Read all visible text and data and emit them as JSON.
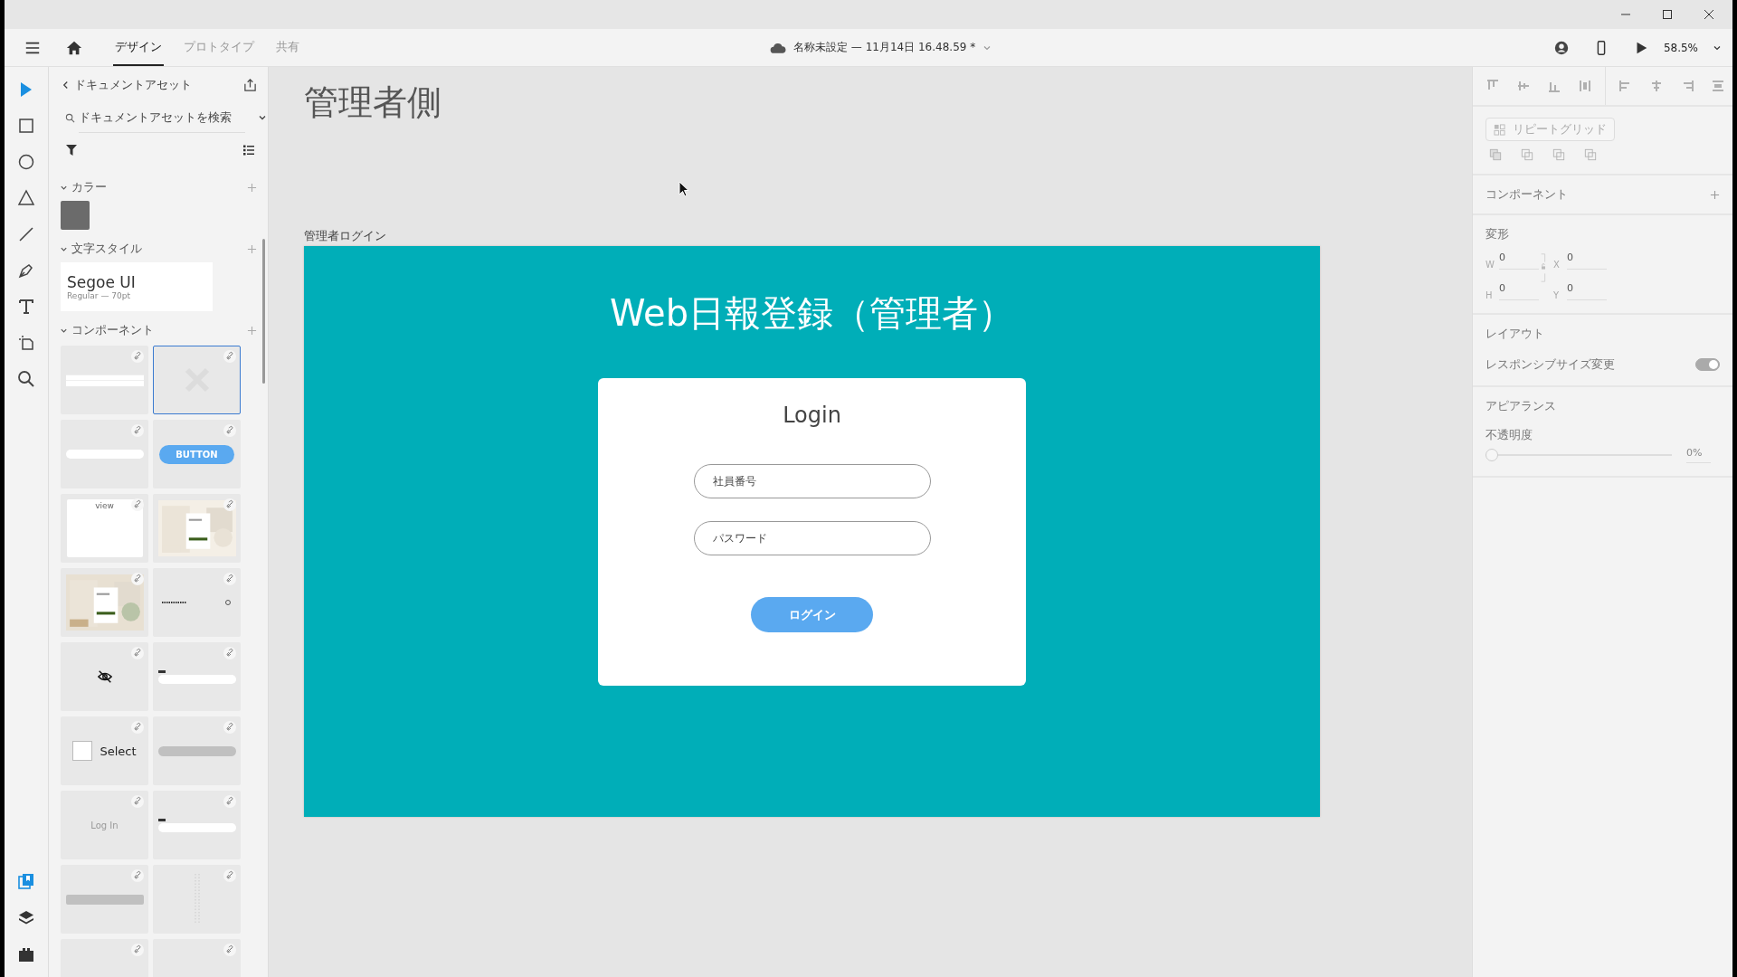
{
  "toolbar": {
    "tabs": [
      {
        "label": "デザイン",
        "selected": true
      },
      {
        "label": "プロトタイプ",
        "selected": false
      },
      {
        "label": "共有",
        "selected": false
      }
    ],
    "document_title": "名称未設定 — 11月14日 16.48.59 *",
    "zoom": "58.5%"
  },
  "tools": [
    {
      "kind": "select",
      "selected": true
    },
    {
      "kind": "rectangle",
      "selected": false
    },
    {
      "kind": "ellipse",
      "selected": false
    },
    {
      "kind": "polygon",
      "selected": false
    },
    {
      "kind": "line",
      "selected": false
    },
    {
      "kind": "pen",
      "selected": false
    },
    {
      "kind": "text",
      "selected": false
    },
    {
      "kind": "artboard",
      "selected": false
    },
    {
      "kind": "zoom",
      "selected": false
    }
  ],
  "panel_tabs": [
    {
      "kind": "assets",
      "selected": true
    },
    {
      "kind": "layers",
      "selected": false
    },
    {
      "kind": "plugins",
      "selected": false
    }
  ],
  "assets": {
    "title": "ドキュメントアセット",
    "search_placeholder": "ドキュメントアセットを検索",
    "colors": {
      "title": "カラー",
      "expanded": true,
      "swatches": [
        {
          "color": "#6b6b6b"
        }
      ]
    },
    "text_styles": {
      "title": "文字スタイル",
      "expanded": true,
      "styles": [
        {
          "name": "Segoe UI",
          "detail": "Regular — 70pt"
        }
      ]
    },
    "components": {
      "title": "コンポーネント",
      "expanded": true,
      "items": [
        {
          "kind": "table",
          "selected": false
        },
        {
          "kind": "missing",
          "selected": true
        },
        {
          "kind": "input",
          "selected": false
        },
        {
          "kind": "button",
          "text": "BUTTON",
          "selected": false
        },
        {
          "kind": "view",
          "text": "view",
          "selected": false
        },
        {
          "kind": "page-picture",
          "selected": false
        },
        {
          "kind": "picture",
          "selected": false
        },
        {
          "kind": "password",
          "selected": false
        },
        {
          "kind": "eye",
          "selected": false
        },
        {
          "kind": "labeled-input",
          "selected": false
        },
        {
          "kind": "checkbox",
          "text": "Select",
          "selected": false
        },
        {
          "kind": "pill",
          "selected": false
        },
        {
          "kind": "text",
          "text": "Log In",
          "selected": false
        },
        {
          "kind": "labeled-input",
          "selected": false
        },
        {
          "kind": "bar",
          "selected": false
        },
        {
          "kind": "dots",
          "selected": false
        },
        {
          "kind": "blank",
          "selected": false
        },
        {
          "kind": "blank",
          "selected": false
        }
      ]
    }
  },
  "canvas": {
    "page_title": "管理者側",
    "artboard": {
      "name": "管理者ログイン",
      "heading": "Web日報登録（管理者）",
      "card": {
        "title": "Login",
        "fields": [
          {
            "placeholder": "社員番号"
          },
          {
            "placeholder": "パスワード"
          }
        ],
        "button": "ログイン"
      }
    }
  },
  "properties": {
    "repeat_grid": {
      "label": "リピートグリッド",
      "disabled": true
    },
    "component_title": "コンポーネント",
    "transform": {
      "title": "変形",
      "fields": [
        {
          "label": "W",
          "value": "0"
        },
        {
          "label": "X",
          "value": "0"
        },
        {
          "label": "H",
          "value": "0"
        },
        {
          "label": "Y",
          "value": "0"
        }
      ]
    },
    "layout": {
      "title": "レイアウト",
      "responsive": {
        "label": "レスポンシブサイズ変更",
        "on": true
      }
    },
    "appearance": {
      "title": "アピアランス",
      "opacity": {
        "label": "不透明度",
        "level": 0,
        "reading": "0%"
      }
    }
  }
}
